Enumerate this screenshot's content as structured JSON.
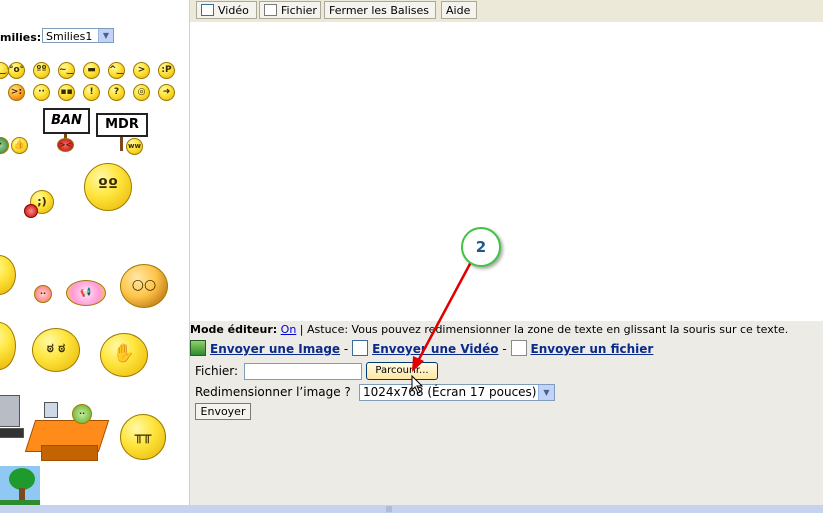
{
  "smilies_panel": {
    "label": "milies:",
    "select_value": "Smilies1",
    "sign_ban": "BAN",
    "sign_mdr": "MDR"
  },
  "toolbar": {
    "buttons": [
      "Vidéo",
      "Fichier",
      "Fermer les Balises",
      "Aide"
    ]
  },
  "mode_line": {
    "label": "Mode éditeur:",
    "on": "On",
    "tip": "| Astuce: Vous pouvez redimensionner la zone de texte en glissant la souris sur ce texte."
  },
  "upload_links": {
    "image": "Envoyer une Image",
    "video": "Envoyer une Vidéo",
    "file": "Envoyer un fichier",
    "separator": "-"
  },
  "form": {
    "file_label": "Fichier:",
    "file_value": "",
    "browse": "Parcourir...",
    "resize_label": "Redimensionner l’image ?",
    "resize_value": "1024x768 (Écran 17 pouces)",
    "submit": "Envoyer"
  },
  "annotation": {
    "number": "2",
    "circle_color": "#44c244",
    "arrow_color": "#e00000"
  }
}
